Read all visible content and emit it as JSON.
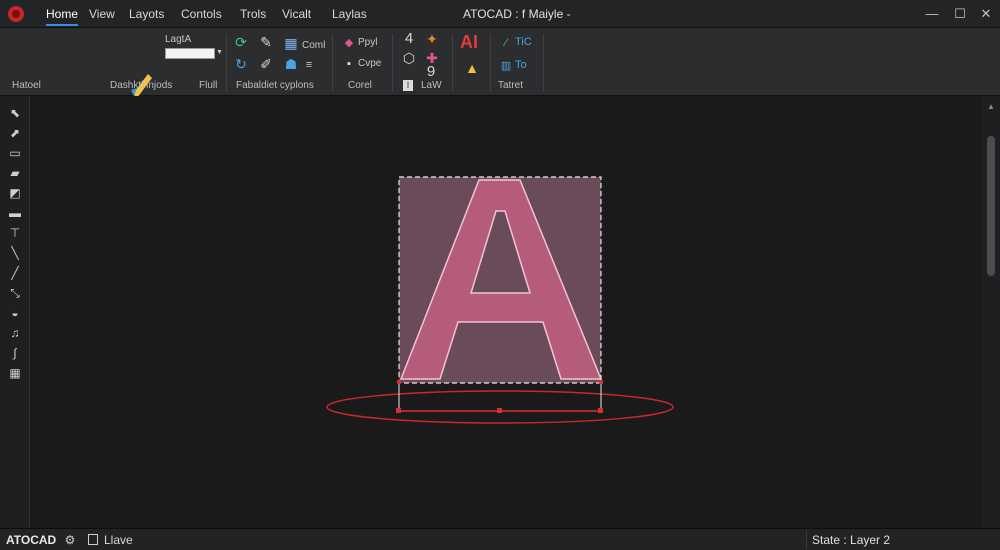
{
  "titlebar": {
    "menus": [
      "Home",
      "View",
      "Layots",
      "Contols",
      "Trols",
      "Vicalt",
      "Laylas"
    ],
    "active_menu": "Home",
    "window_title": "ATOCAD : f Maiyle -",
    "controls": {
      "minimize": "—",
      "maximize": "☐",
      "close": "✕"
    }
  },
  "ribbon": {
    "group_labels": {
      "g1": "Hatoel",
      "g2": "Dashktl lnjods",
      "g3": "Flull",
      "g4": "Fabaldiet cyplons",
      "g5": "Corel",
      "g6": "LaW",
      "g7": "Tatret"
    },
    "texts": {
      "name_label": "LagtA",
      "t_coml": "Coml",
      "t_ppyl": "Ppyl",
      "t_cvpe": "Cvpe",
      "t_ai": "AI",
      "t_tic": "TiC",
      "t_to": "To",
      "t_four": "4",
      "t_nine": "9",
      "t_l": "l"
    },
    "icons": [
      "pen-ruler-icon",
      "arrow-cycle-icon",
      "pencil-icon",
      "calendar-icon",
      "brush-icon",
      "user-group-icon",
      "layer-color-icon",
      "stamp-icon",
      "cube-icon",
      "ai-icon",
      "warning-icon",
      "ruler-icon",
      "table-icon"
    ]
  },
  "left_toolbar": {
    "tools": [
      "select-icon",
      "pick-icon",
      "layer-icon",
      "comment-icon",
      "cloud-icon",
      "rectangle-icon",
      "text-icon",
      "line-icon",
      "pen-icon",
      "pencil-icon",
      "erase-icon",
      "music-icon",
      "curve-icon",
      "grid-icon"
    ]
  },
  "canvas": {
    "letter": "A",
    "colors": {
      "letter_fill": "#b45c79",
      "letter_stroke": "#f4c2d6",
      "selection_fill": "#6a4b59",
      "selection_stroke": "#e6e6e6",
      "ellipse_stroke": "#c9282c",
      "grip": "#d23237"
    }
  },
  "statusbar": {
    "app_name": "ATOCAD",
    "layer_label": "Llave",
    "state_text": "State : Layer 2"
  },
  "colors": {
    "accent": "#3d8be6",
    "background": "#1a1a1a",
    "ribbon": "#2b2d2f"
  }
}
